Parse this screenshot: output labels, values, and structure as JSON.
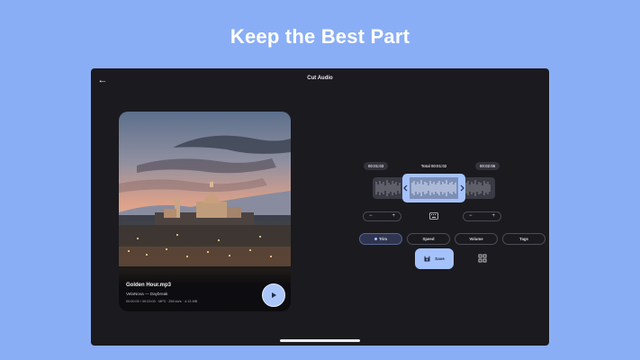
{
  "promo": {
    "headline": "Keep the Best Part"
  },
  "app": {
    "title": "Cut Audio"
  },
  "track": {
    "name": "Golden Hour.mp3",
    "artist": "VelaNova — Daybreak",
    "meta": "00:00:00 / 00:03:00 · MP3 · 256 kb/s · 4.13 MB"
  },
  "trim": {
    "start_time": "00:01:03",
    "total_label": "Total 00:01:02",
    "end_time": "00:02:05",
    "minus": "−",
    "plus": "+"
  },
  "tabs": [
    {
      "label": "Trim",
      "active": true
    },
    {
      "label": "Speed",
      "active": false
    },
    {
      "label": "Volume",
      "active": false
    },
    {
      "label": "Tags",
      "active": false
    }
  ],
  "save": {
    "label": "Save"
  },
  "colors": {
    "background": "#8aaef5",
    "device": "#1b1a1f",
    "accent": "#a6c2fb"
  },
  "icons": [
    "back-arrow-icon",
    "play-icon",
    "keyboard-icon",
    "save-icon",
    "grid-icon"
  ]
}
